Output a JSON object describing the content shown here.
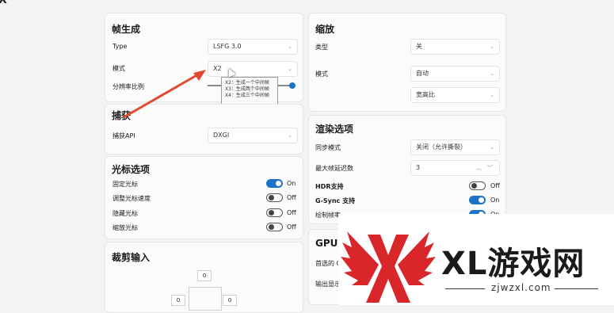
{
  "frame_gen": {
    "title": "帧生成",
    "type_label": "Type",
    "type_value": "LSFG 3.0",
    "mode_label": "模式",
    "mode_value": "X2",
    "scale_label": "分辨率比例",
    "tooltip": [
      "X2：生成一个中间帧",
      "X3：生成两个中间帧",
      "X4：生成三个中间帧"
    ]
  },
  "capture": {
    "title": "捕获",
    "api_label": "捕获API",
    "api_value": "DXGI"
  },
  "cursor": {
    "title": "光标选项",
    "items": [
      {
        "label": "固定光标",
        "state": "On"
      },
      {
        "label": "调整光标速度",
        "state": "Off"
      },
      {
        "label": "隐藏光标",
        "state": "Off"
      },
      {
        "label": "缩放光标",
        "state": "Off"
      }
    ]
  },
  "crop": {
    "title": "裁剪输入",
    "top": "0",
    "left": "0",
    "right": "0"
  },
  "scaling": {
    "title": "缩放",
    "type_label": "类型",
    "type_value": "关",
    "mode_label": "模式",
    "mode_value": "自动",
    "aspect_value": "宽高比"
  },
  "render": {
    "title": "渲染选项",
    "sync_label": "同步模式",
    "sync_value": "关闭（允许撕裂）",
    "maxframes_label": "最大帧延迟数",
    "maxframes_value": "3",
    "hdr_label": "HDR支持",
    "hdr_state": "Off",
    "gsync_label": "G-Sync 支持",
    "gsync_state": "On",
    "draw_label": "绘制帧率",
    "draw_state": "On"
  },
  "gpu": {
    "title": "GPU",
    "preferred_label": "首选的 G",
    "output_label": "输出显示"
  },
  "watermark": {
    "brand": "XL游戏网",
    "url": "zjwzxl.com",
    "colors": {
      "red": "#d8262b",
      "dark": "#1a1a1a"
    }
  },
  "top_glyph": "X"
}
